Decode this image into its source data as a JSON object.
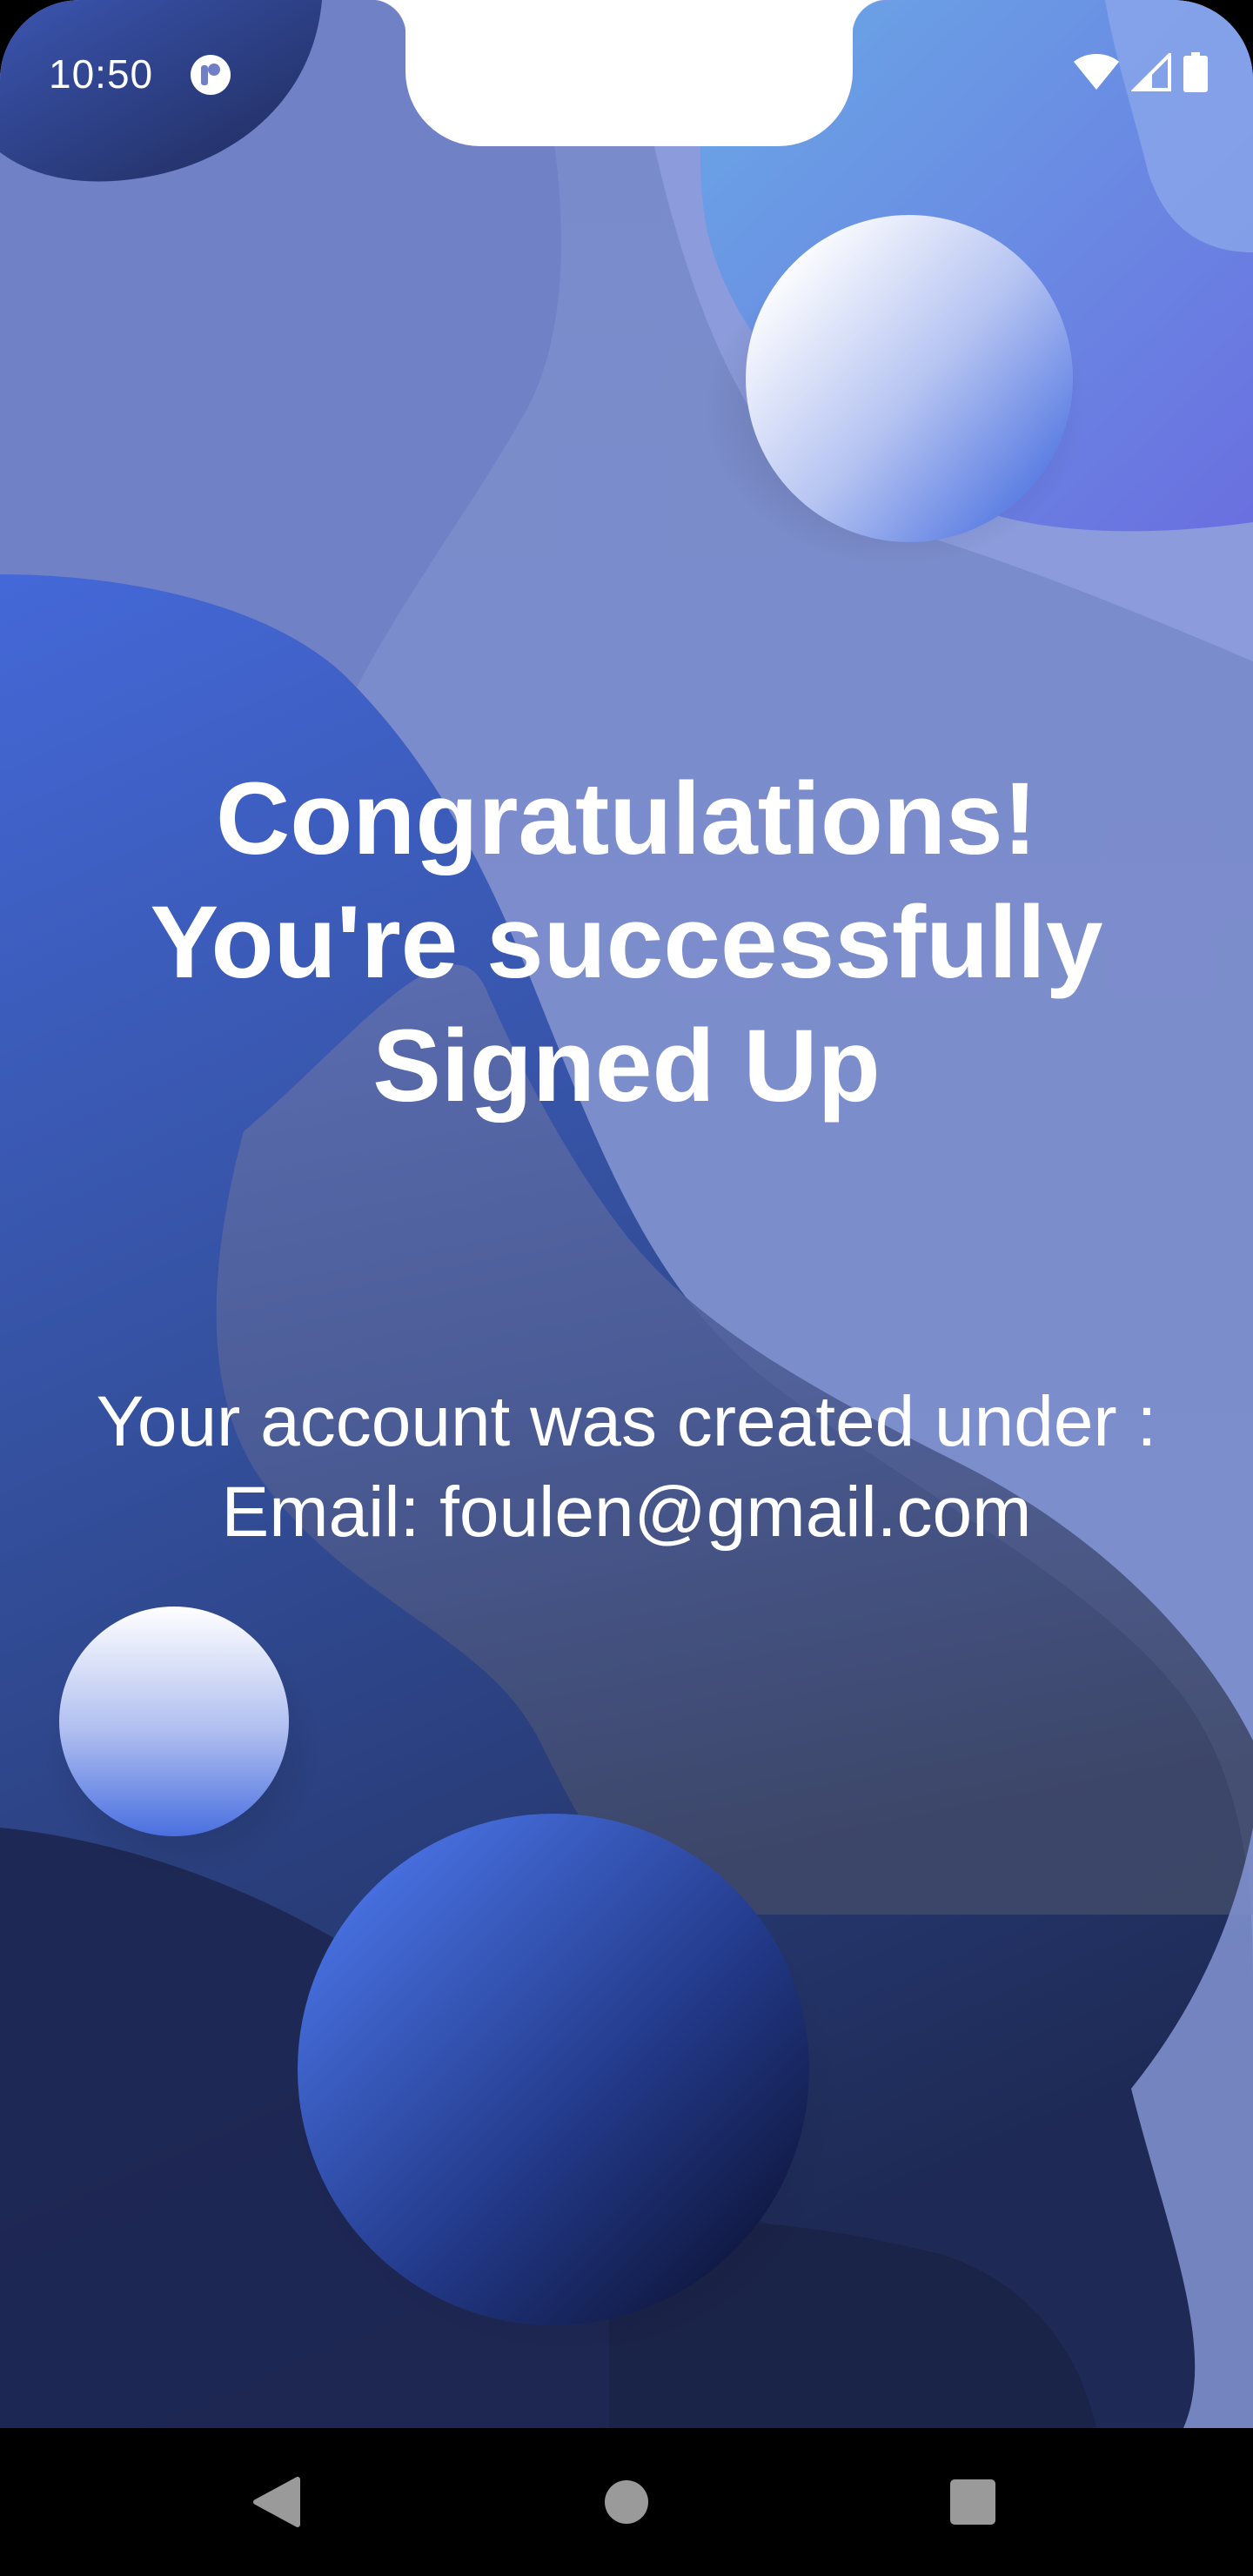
{
  "status_bar": {
    "time": "10:50",
    "icons": [
      "app-notification-icon",
      "wifi-icon",
      "signal-icon",
      "battery-icon"
    ]
  },
  "main": {
    "headline_lines": [
      "Congratulations!",
      "You're successfully",
      "Signed Up"
    ],
    "detail_lines": [
      "Your account was created under :",
      "Email: foulen@gmail.com"
    ]
  },
  "nav_bar": {
    "icons": [
      "back-icon",
      "home-icon",
      "recents-icon"
    ],
    "icon_color": "#9a9a9a"
  },
  "colors": {
    "background_light": "#7f8fcc",
    "background_dark": "#1e2a55",
    "accent_blue": "#4a70e0",
    "text": "#ffffff"
  }
}
